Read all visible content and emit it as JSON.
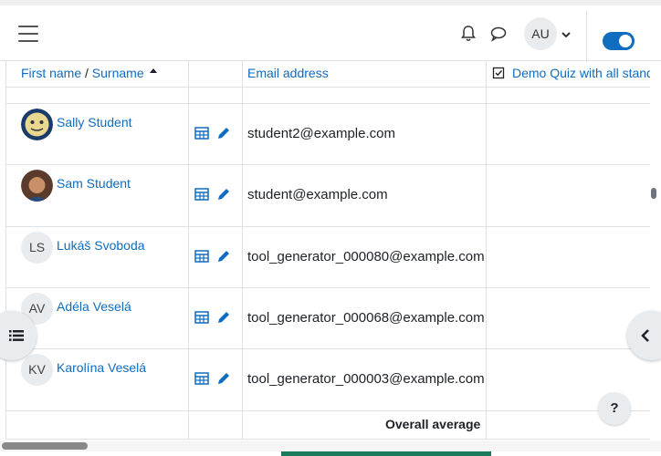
{
  "header": {
    "avatar_initials": "AU",
    "icons": [
      "menu-icon",
      "bell-icon",
      "chat-icon",
      "chevron-down-icon"
    ],
    "accent_color": "#0f6cbf"
  },
  "table": {
    "columns": {
      "first_name": "First name",
      "separator": " / ",
      "surname": "Surname",
      "email": "Email address",
      "quiz": "Demo Quiz with all standard question types"
    },
    "rows": [
      {
        "name": "Sally Student",
        "initials": "",
        "email": "student2@example.com"
      },
      {
        "name": "Sam Student",
        "initials": "",
        "email": "student@example.com"
      },
      {
        "name": "Lukáš Svoboda",
        "initials": "LS",
        "email": "tool_generator_000080@example.com"
      },
      {
        "name": "Adéla Veselá",
        "initials": "AV",
        "email": "tool_generator_000068@example.com"
      },
      {
        "name": "Karolína Veselá",
        "initials": "KV",
        "email": "tool_generator_000003@example.com"
      }
    ],
    "overall_average": "Overall average"
  },
  "help_label": "?"
}
